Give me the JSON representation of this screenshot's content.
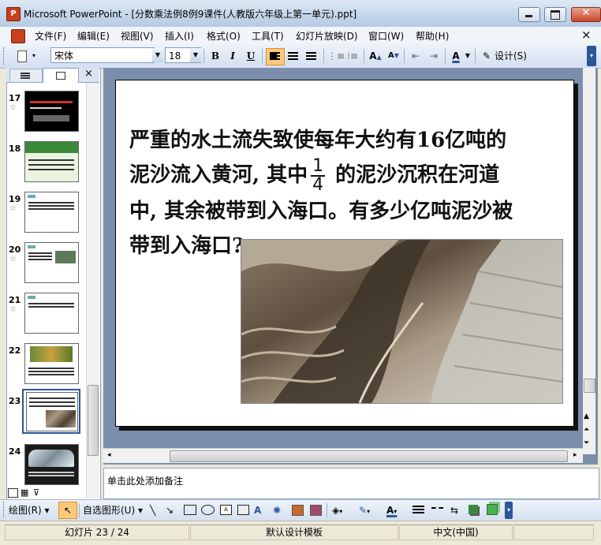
{
  "window": {
    "app_icon": "P",
    "title": "Microsoft PowerPoint - [分数乘法例8例9课件(人教版六年级上第一单元).ppt]"
  },
  "menu": {
    "items": [
      "文件(F)",
      "编辑(E)",
      "视图(V)",
      "插入(I)",
      "格式(O)",
      "工具(T)",
      "幻灯片放映(D)",
      "窗口(W)",
      "帮助(H)"
    ],
    "close_label": "×"
  },
  "toolbar": {
    "font_name": "宋体",
    "font_size": "18",
    "bold": "B",
    "italic": "I",
    "underline": "U",
    "design_label": "设计(S)"
  },
  "slides_panel": {
    "close_label": "×",
    "slides": [
      {
        "number": "17",
        "star": "☆"
      },
      {
        "number": "18",
        "star": ""
      },
      {
        "number": "19",
        "star": "☆"
      },
      {
        "number": "20",
        "star": "☆"
      },
      {
        "number": "21",
        "star": "☆"
      },
      {
        "number": "22",
        "star": ""
      },
      {
        "number": "23",
        "star": ""
      },
      {
        "number": "24",
        "star": ""
      }
    ],
    "selected": "23"
  },
  "slide": {
    "line1": "严重的水土流失致使每年大约有16亿吨的",
    "line2_before": "泥沙流入黄河, 其中",
    "fraction_num": "1",
    "fraction_den": "4",
    "line2_after": " 的泥沙沉积在河道",
    "line3": "中, 其余被带到入海口。有多少亿吨泥沙被",
    "line4": "带到入海口?"
  },
  "notes": {
    "placeholder": "单击此处添加备注"
  },
  "drawing_toolbar": {
    "draw_label": "绘图(R)",
    "autoshape_label": "自选图形(U)"
  },
  "status": {
    "slide_counter": "幻灯片 23 / 24",
    "template": "默认设计模板",
    "language": "中文(中国)"
  },
  "colors": {
    "accent": "#2b5797",
    "titlebar": "#c3d5ea",
    "workspace": "#7b8fac"
  }
}
